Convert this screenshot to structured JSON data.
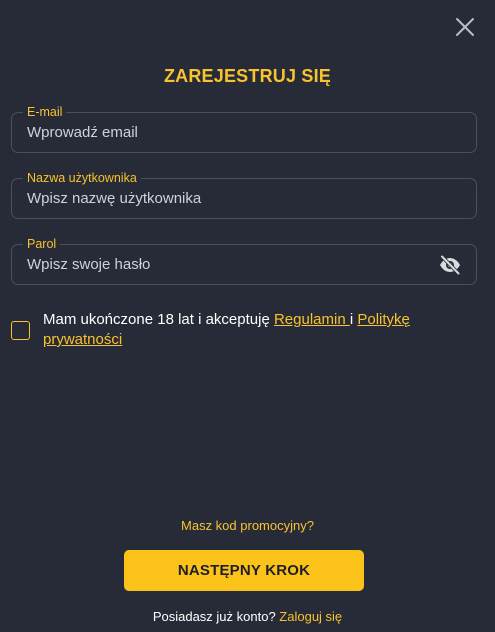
{
  "colors": {
    "background": "#272a37",
    "accent": "#f7c32e",
    "button": "#fbc21a",
    "border": "#4a4e5f"
  },
  "modal": {
    "title": "ZAREJESTRUJ SIĘ",
    "close_icon": "close-icon"
  },
  "form": {
    "email": {
      "label": "E-mail",
      "placeholder": "Wprowadź email",
      "value": ""
    },
    "username": {
      "label": "Nazwa użytkownika",
      "placeholder": "Wpisz nazwę użytkownika",
      "value": ""
    },
    "password": {
      "label": "Parol",
      "placeholder": "Wpisz swoje hasło",
      "value": "",
      "toggle_icon": "eye-slash-icon"
    }
  },
  "consent": {
    "checked": false,
    "text_before": "Mam ukończone 18 lat i akceptuję ",
    "terms_link": "Regulamin ",
    "conjunction": " i ",
    "privacy_link": "Politykę prywatności"
  },
  "promo_link": "Masz kod promocyjny?",
  "next_button": "NASTĘPNY KROK",
  "login": {
    "prompt": "Posiadasz już konto? ",
    "link": "Zaloguj się"
  }
}
